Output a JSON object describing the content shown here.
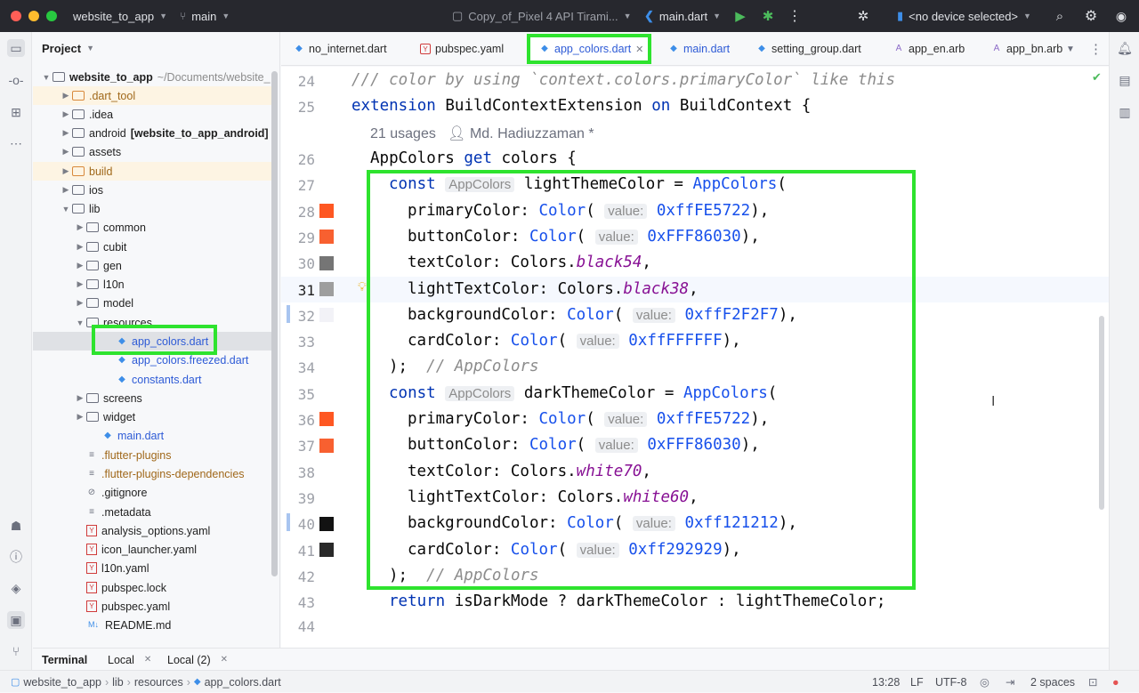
{
  "titlebar": {
    "project": "website_to_app",
    "branch": "main",
    "device_config": "Copy_of_Pixel 4 API Tirami...",
    "run_config": "main.dart",
    "device": "<no device selected>"
  },
  "project_panel": {
    "title": "Project",
    "tree": [
      {
        "label": "website_to_app",
        "suffix": "~/Documents/website_",
        "kind": "root"
      },
      {
        "label": ".dart_tool",
        "kind": "folder-orange"
      },
      {
        "label": ".idea",
        "kind": "folder"
      },
      {
        "label": "android",
        "suffix": "[website_to_app_android]",
        "kind": "folder"
      },
      {
        "label": "assets",
        "kind": "folder"
      },
      {
        "label": "build",
        "kind": "folder-orange"
      },
      {
        "label": "ios",
        "kind": "folder"
      },
      {
        "label": "lib",
        "kind": "folder"
      },
      {
        "label": "common",
        "kind": "folder"
      },
      {
        "label": "cubit",
        "kind": "folder"
      },
      {
        "label": "gen",
        "kind": "folder"
      },
      {
        "label": "l10n",
        "kind": "folder"
      },
      {
        "label": "model",
        "kind": "folder"
      },
      {
        "label": "resources",
        "kind": "folder"
      },
      {
        "label": "app_colors.dart",
        "kind": "dart"
      },
      {
        "label": "app_colors.freezed.dart",
        "kind": "dart"
      },
      {
        "label": "constants.dart",
        "kind": "dart"
      },
      {
        "label": "screens",
        "kind": "folder"
      },
      {
        "label": "widget",
        "kind": "folder"
      },
      {
        "label": "main.dart",
        "kind": "dart"
      },
      {
        "label": ".flutter-plugins",
        "kind": "file"
      },
      {
        "label": ".flutter-plugins-dependencies",
        "kind": "file"
      },
      {
        "label": ".gitignore",
        "kind": "file"
      },
      {
        "label": ".metadata",
        "kind": "file"
      },
      {
        "label": "analysis_options.yaml",
        "kind": "yaml"
      },
      {
        "label": "icon_launcher.yaml",
        "kind": "yaml"
      },
      {
        "label": "l10n.yaml",
        "kind": "yaml"
      },
      {
        "label": "pubspec.lock",
        "kind": "yaml"
      },
      {
        "label": "pubspec.yaml",
        "kind": "yaml"
      },
      {
        "label": "README.md",
        "kind": "md"
      }
    ]
  },
  "tabs": [
    {
      "label": "no_internet.dart"
    },
    {
      "label": "pubspec.yaml"
    },
    {
      "label": "app_colors.dart"
    },
    {
      "label": "main.dart"
    },
    {
      "label": "setting_group.dart"
    },
    {
      "label": "app_en.arb"
    },
    {
      "label": "app_bn.arb"
    }
  ],
  "editor": {
    "line_numbers": [
      "24",
      "25",
      "26",
      "27",
      "28",
      "29",
      "30",
      "31",
      "32",
      "33",
      "34",
      "35",
      "36",
      "37",
      "38",
      "39",
      "40",
      "41",
      "42",
      "43",
      "44"
    ],
    "usages": "21 usages",
    "author": "Md. Hadiuzzaman *",
    "lines": {
      "l24": "/// color by using `context.colors.primaryColor` like this",
      "l25_kw": "extension",
      "l25_name": "BuildContextExtension",
      "l25_on": "on",
      "l25_type": "BuildContext {",
      "l26_type": "AppColors",
      "l26_get": "get",
      "l26_rest": "colors {",
      "const": "const",
      "hint_type": "AppColors",
      "light_var": "lightThemeColor =",
      "dark_var": "darkThemeColor =",
      "ctor": "AppColors",
      "paren": "(",
      "hint_value": "value:",
      "primaryColor": "primaryColor:",
      "buttonColor": "buttonColor:",
      "textColor": "textColor: Colors.",
      "lightTextColor": "lightTextColor: Colors.",
      "backgroundColor": "backgroundColor:",
      "cardColor": "cardColor:",
      "color_fn": "Color",
      "l_primary": "0xffFE5722",
      "l_button": "0xFFF86030",
      "l_text": "black54",
      "l_lighttext": "black38",
      "l_bg": "0xffF2F2F7",
      "l_card": "0xffFFFFFF",
      "d_primary": "0xffFE5722",
      "d_button": "0xFFF86030",
      "d_text": "white70",
      "d_lighttext": "white60",
      "d_bg": "0xff121212",
      "d_card": "0xff292929",
      "close": ");",
      "close_comment": "// AppColors",
      "l43_return": "return",
      "l43_rest": "isDarkMode ? darkThemeColor : lightThemeColor;"
    },
    "swatches": {
      "l28": "#FE5722",
      "l29": "#F86030",
      "l30": "#757575",
      "l31": "#9E9E9E",
      "l32": "#F2F2F7",
      "l33": "#FFFFFF",
      "l36": "#FE5722",
      "l37": "#F86030",
      "l40": "#121212",
      "l41": "#292929"
    }
  },
  "bottom": {
    "terminal": "Terminal",
    "local": "Local",
    "local2": "Local (2)"
  },
  "status": {
    "crumbs": [
      "website_to_app",
      "lib",
      "resources",
      "app_colors.dart"
    ],
    "position": "13:28",
    "line_sep": "LF",
    "encoding": "UTF-8",
    "indent": "2 spaces"
  },
  "colors": {
    "highlight_box": "#2ee32e",
    "titlebar_bg": "#27282e"
  }
}
